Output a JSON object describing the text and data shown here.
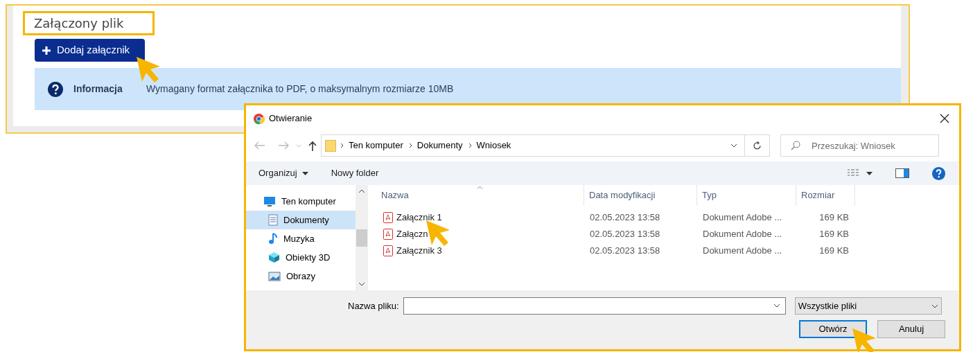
{
  "section": {
    "title": "Załączony plik",
    "add_button": "Dodaj załącznik",
    "info": {
      "label": "Informacja",
      "text": "Wymagany format załącznika to PDF, o maksymalnym rozmiarze 10MB"
    }
  },
  "dialog": {
    "title": "Otwieranie",
    "breadcrumb": [
      "Ten komputer",
      "Dokumenty",
      "Wniosek"
    ],
    "search": {
      "placeholder": "Przeszukaj: Wniosek"
    },
    "toolbar": [
      {
        "label": "Organizuj",
        "kind": "menu"
      },
      {
        "label": "Nowy folder",
        "kind": "plain"
      }
    ],
    "nav": [
      {
        "label": "Ten komputer",
        "kind": "computer",
        "selected": false,
        "children": [
          {
            "label": "Dokumenty",
            "kind": "documents",
            "selected": true
          },
          {
            "label": "Muzyka",
            "kind": "music",
            "selected": false
          },
          {
            "label": "Obiekty 3D",
            "kind": "objects",
            "selected": false
          },
          {
            "label": "Obrazy",
            "kind": "pictures",
            "selected": false
          }
        ]
      }
    ],
    "columns": [
      "Nazwa",
      "Data modyfikacji",
      "Typ",
      "Rozmiar"
    ],
    "files": [
      {
        "name": "Załącznik 1",
        "date": "02.05.2023 13:58",
        "type": "Dokument Adobe ...",
        "size": "169 KB"
      },
      {
        "name": "Załączn",
        "date": "02.05.2023 13:58",
        "type": "Dokument Adobe ...",
        "size": "169 KB"
      },
      {
        "name": "Załącznik 3",
        "date": "02.05.2023 13:58",
        "type": "Dokument Adobe ...",
        "size": "169 KB"
      }
    ],
    "filename_label": "Nazwa pliku:",
    "filetype": "Wszystkie pliki",
    "buttons": [
      {
        "label": "Otwórz",
        "kind": "primary"
      },
      {
        "label": "Anuluj",
        "kind": "secondary"
      }
    ]
  }
}
